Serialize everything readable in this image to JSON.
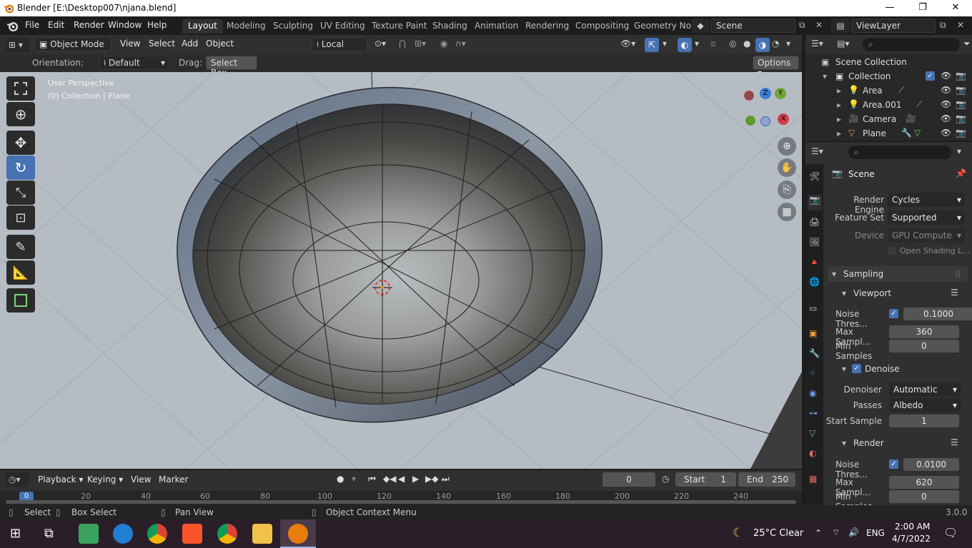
{
  "window": {
    "title": "Blender [E:\\Desktop007\\njana.blend]"
  },
  "menus": [
    "File",
    "Edit",
    "Render",
    "Window",
    "Help"
  ],
  "workspaces": [
    "Layout",
    "Modeling",
    "Sculpting",
    "UV Editing",
    "Texture Paint",
    "Shading",
    "Animation",
    "Rendering",
    "Compositing",
    "Geometry No"
  ],
  "active_workspace": "Layout",
  "scene_field": "Scene",
  "viewlayer_field": "ViewLayer",
  "viewport_header": {
    "mode": "Object Mode",
    "menus": [
      "View",
      "Select",
      "Add",
      "Object"
    ],
    "transform_orientation": "Local"
  },
  "tool_settings": {
    "orientation_label": "Orientation:",
    "orientation_value": "Default",
    "drag_label": "Drag:",
    "drag_value": "Select Box",
    "options": "Options"
  },
  "viewport_overlay": {
    "line1": "User Perspective",
    "line2": "(0) Collection | Plane"
  },
  "gizmo": {
    "z": "Z",
    "y": "Y",
    "x": "X"
  },
  "outliner": {
    "root": "Scene Collection",
    "collection": "Collection",
    "items": [
      "Area",
      "Area.001",
      "Camera",
      "Plane"
    ]
  },
  "properties": {
    "context": "Scene",
    "render_engine_label": "Render Engine",
    "render_engine": "Cycles",
    "feature_set_label": "Feature Set",
    "feature_set": "Supported",
    "device_label": "Device",
    "device": "GPU Compute",
    "open_shading": "Open Shading L...",
    "sampling": "Sampling",
    "viewport": {
      "title": "Viewport",
      "noise_label": "Noise Thres...",
      "noise": "0.1000",
      "max_label": "Max Sampl...",
      "max": "360",
      "min_label": "Min Samples",
      "min": "0"
    },
    "denoise": {
      "title": "Denoise",
      "denoiser_label": "Denoiser",
      "denoiser": "Automatic",
      "passes_label": "Passes",
      "passes": "Albedo",
      "start_label": "Start Sample",
      "start": "1"
    },
    "render": {
      "title": "Render",
      "noise_label": "Noise Thres...",
      "noise": "0.0100",
      "max_label": "Max Sampl...",
      "max": "620",
      "min_label": "Min Samples",
      "min": "0"
    }
  },
  "timeline": {
    "menus": [
      "Playback",
      "Keying",
      "View",
      "Marker"
    ],
    "current_frame": "0",
    "start_label": "Start",
    "start": "1",
    "end_label": "End",
    "end": "250",
    "ruler": [
      "0",
      "20",
      "40",
      "60",
      "80",
      "100",
      "120",
      "140",
      "160",
      "180",
      "200",
      "220",
      "240"
    ]
  },
  "statusbar": {
    "select": "Select",
    "box_select": "Box Select",
    "pan_view": "Pan View",
    "context_menu": "Object Context Menu",
    "version": "3.0.0"
  },
  "taskbar": {
    "weather": "25°C  Clear",
    "lang": "ENG",
    "time": "2:00 AM",
    "date": "4/7/2022"
  },
  "colors": {
    "accent": "#4772b3",
    "viewport_bg": "#b6bcc3"
  }
}
